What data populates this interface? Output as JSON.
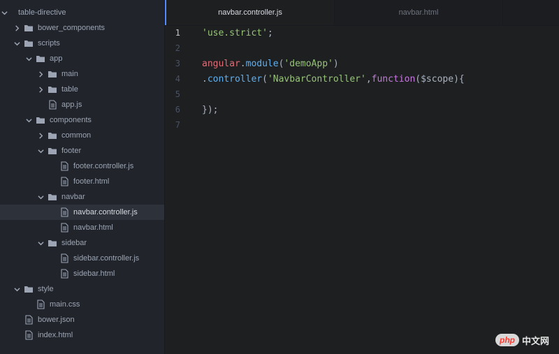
{
  "sidebar": {
    "items": [
      {
        "label": "table-directive",
        "type": "folder",
        "open": true,
        "depth": 0
      },
      {
        "label": "bower_components",
        "type": "folder",
        "open": false,
        "depth": 1
      },
      {
        "label": "scripts",
        "type": "folder",
        "open": true,
        "depth": 1
      },
      {
        "label": "app",
        "type": "folder",
        "open": true,
        "depth": 2
      },
      {
        "label": "main",
        "type": "folder",
        "open": false,
        "depth": 3
      },
      {
        "label": "table",
        "type": "folder",
        "open": false,
        "depth": 3
      },
      {
        "label": "app.js",
        "type": "file",
        "depth": 3
      },
      {
        "label": "components",
        "type": "folder",
        "open": true,
        "depth": 2
      },
      {
        "label": "common",
        "type": "folder",
        "open": false,
        "depth": 3
      },
      {
        "label": "footer",
        "type": "folder",
        "open": true,
        "depth": 3
      },
      {
        "label": "footer.controller.js",
        "type": "file",
        "depth": 4
      },
      {
        "label": "footer.html",
        "type": "file",
        "depth": 4
      },
      {
        "label": "navbar",
        "type": "folder",
        "open": true,
        "depth": 3
      },
      {
        "label": "navbar.controller.js",
        "type": "file",
        "depth": 4,
        "selected": true
      },
      {
        "label": "navbar.html",
        "type": "file",
        "depth": 4
      },
      {
        "label": "sidebar",
        "type": "folder",
        "open": true,
        "depth": 3
      },
      {
        "label": "sidebar.controller.js",
        "type": "file",
        "depth": 4
      },
      {
        "label": "sidebar.html",
        "type": "file",
        "depth": 4
      },
      {
        "label": "style",
        "type": "folder",
        "open": true,
        "depth": 1
      },
      {
        "label": "main.css",
        "type": "file",
        "depth": 2
      },
      {
        "label": "bower.json",
        "type": "file",
        "depth": 1
      },
      {
        "label": "index.html",
        "type": "file",
        "depth": 1
      }
    ]
  },
  "tabs": [
    {
      "label": "navbar.controller.js",
      "active": true
    },
    {
      "label": "navbar.html",
      "active": false
    }
  ],
  "editor": {
    "current_line": 1,
    "lines": [
      {
        "num": "1",
        "tokens": [
          {
            "t": "'use.strict'",
            "c": "str"
          },
          {
            "t": ";",
            "c": "punc"
          }
        ]
      },
      {
        "num": "2",
        "tokens": []
      },
      {
        "num": "3",
        "tokens": [
          {
            "t": "angular",
            "c": "ident"
          },
          {
            "t": ".",
            "c": "punc"
          },
          {
            "t": "module",
            "c": "prop"
          },
          {
            "t": "(",
            "c": "punc"
          },
          {
            "t": "'demoApp'",
            "c": "str"
          },
          {
            "t": ")",
            "c": "punc"
          }
        ]
      },
      {
        "num": "4",
        "tokens": [
          {
            "t": ".",
            "c": "punc"
          },
          {
            "t": "controller",
            "c": "prop"
          },
          {
            "t": "(",
            "c": "punc"
          },
          {
            "t": "'NavbarController'",
            "c": "str"
          },
          {
            "t": ",",
            "c": "punc"
          },
          {
            "t": "function",
            "c": "kw"
          },
          {
            "t": "($scope){",
            "c": "punc"
          }
        ]
      },
      {
        "num": "5",
        "tokens": []
      },
      {
        "num": "6",
        "tokens": [
          {
            "t": "});",
            "c": "punc"
          }
        ]
      },
      {
        "num": "7",
        "tokens": []
      }
    ]
  },
  "watermark": {
    "badge": "php",
    "text": "中文网"
  },
  "colors": {
    "accent": "#528bff",
    "folder": "#9da5b4",
    "selected_bg": "#2c313a"
  }
}
